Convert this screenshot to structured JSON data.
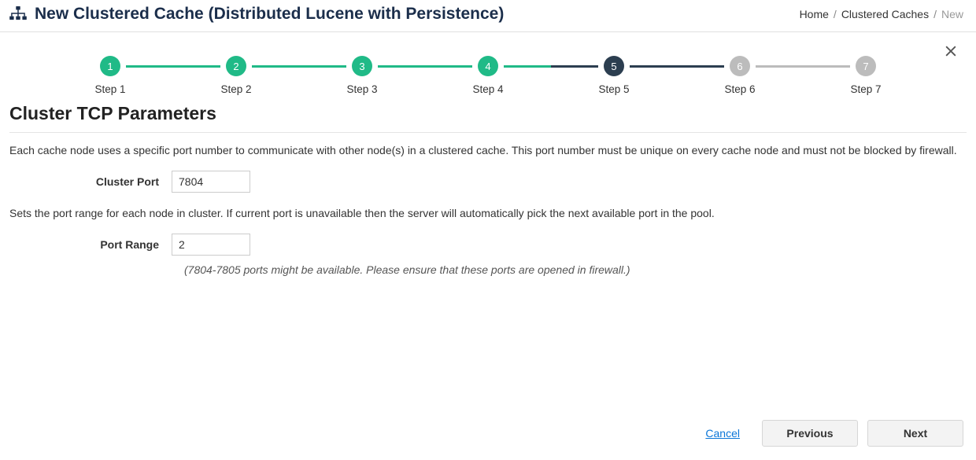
{
  "header": {
    "title": "New Clustered Cache (Distributed Lucene with Persistence)"
  },
  "breadcrumb": {
    "home": "Home",
    "mid": "Clustered Caches",
    "leaf": "New"
  },
  "stepper": {
    "steps": [
      {
        "num": "1",
        "label": "Step 1"
      },
      {
        "num": "2",
        "label": "Step 2"
      },
      {
        "num": "3",
        "label": "Step 3"
      },
      {
        "num": "4",
        "label": "Step 4"
      },
      {
        "num": "5",
        "label": "Step 5"
      },
      {
        "num": "6",
        "label": "Step 6"
      },
      {
        "num": "7",
        "label": "Step 7"
      }
    ]
  },
  "section": {
    "title": "Cluster TCP Parameters",
    "desc1": "Each cache node uses a specific port number to communicate with other node(s) in a clustered cache. This port number must be unique on every cache node and must not be blocked by firewall.",
    "clusterPortLabel": "Cluster Port",
    "clusterPortValue": "7804",
    "desc2": "Sets the port range for each node in cluster. If current port is unavailable then the server will automatically pick the next available port in the pool.",
    "portRangeLabel": "Port Range",
    "portRangeValue": "2",
    "hint": "(7804-7805 ports might be available. Please ensure that these ports are opened in firewall.)"
  },
  "footer": {
    "cancel": "Cancel",
    "previous": "Previous",
    "next": "Next"
  }
}
